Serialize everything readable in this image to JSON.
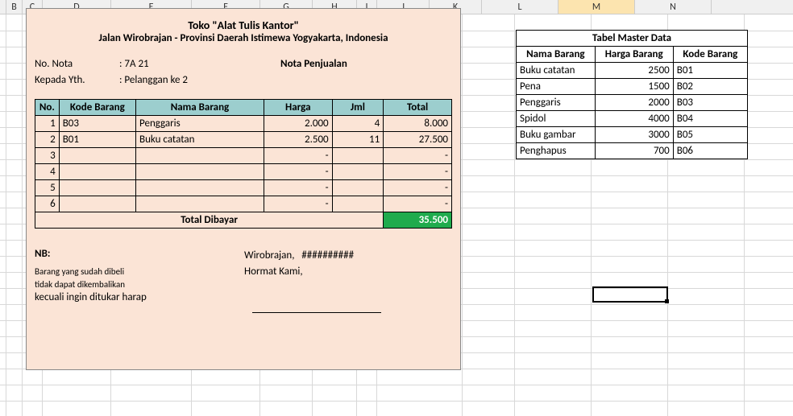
{
  "columns": [
    "B",
    "C",
    "D",
    "E",
    "F",
    "G",
    "H",
    "I",
    "J",
    "K",
    "L",
    "M",
    "N"
  ],
  "selected_column": "M",
  "invoice": {
    "title": "Toko \"Alat Tulis Kantor\"",
    "subtitle": "Jalan Wirobrajan  - Provinsi Daerah Istimewa Yogyakarta, Indonesia",
    "no_nota_label": "No. Nota",
    "no_nota_value": ": 7A 21",
    "kepada_label": "Kepada Yth.",
    "kepada_value": ": Pelanggan ke 2",
    "nota_title": "Nota Penjualan",
    "headers": {
      "no": "No.",
      "kode": "Kode Barang",
      "nama": "Nama Barang",
      "harga": "Harga",
      "jml": "Jml",
      "total": "Total"
    },
    "rows": [
      {
        "no": "1",
        "kode": "B03",
        "nama": "Penggaris",
        "harga": "2.000",
        "jml": "4",
        "total": "8.000"
      },
      {
        "no": "2",
        "kode": "B01",
        "nama": "Buku catatan",
        "harga": "2.500",
        "jml": "11",
        "total": "27.500"
      },
      {
        "no": "3",
        "kode": "",
        "nama": "",
        "harga": "-",
        "jml": "",
        "total": "-"
      },
      {
        "no": "4",
        "kode": "",
        "nama": "",
        "harga": "-",
        "jml": "",
        "total": "-"
      },
      {
        "no": "5",
        "kode": "",
        "nama": "",
        "harga": "-",
        "jml": "",
        "total": "-"
      },
      {
        "no": "6",
        "kode": "",
        "nama": "",
        "harga": "-",
        "jml": "",
        "total": "-"
      }
    ],
    "total_label": "Total Dibayar",
    "total_value": "35.500",
    "footer": {
      "nb_label": "NB:",
      "nb_line1": "Barang yang sudah dibeli",
      "nb_line2": "tidak dapat dikembalikan",
      "nb_line3": "kecuali ingin ditukar harap",
      "place": "Wirobrajan,",
      "date": "##########",
      "hormat": "Hormat Kami,"
    }
  },
  "master": {
    "title": "Tabel Master Data",
    "headers": {
      "nama": "Nama Barang",
      "harga": "Harga Barang",
      "kode": "Kode Barang"
    },
    "rows": [
      {
        "nama": "Buku catatan",
        "harga": "2500",
        "kode": "B01"
      },
      {
        "nama": "Pena",
        "harga": "1500",
        "kode": "B02"
      },
      {
        "nama": "Penggaris",
        "harga": "2000",
        "kode": "B03"
      },
      {
        "nama": "Spidol",
        "harga": "4000",
        "kode": "B04"
      },
      {
        "nama": "Buku gambar",
        "harga": "3000",
        "kode": "B05"
      },
      {
        "nama": "Penghapus",
        "harga": "700",
        "kode": "B06"
      }
    ]
  }
}
